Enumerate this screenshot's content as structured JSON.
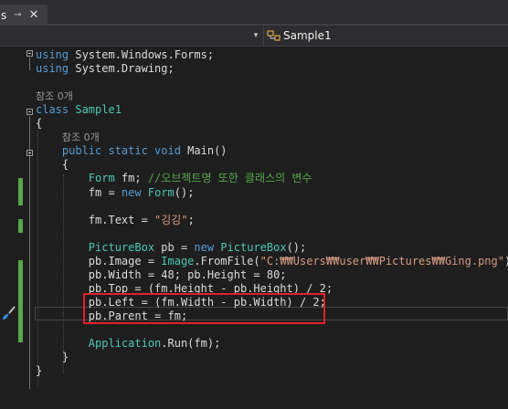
{
  "tab": {
    "label": "s",
    "pin": "⊸",
    "close": "✕"
  },
  "navbar": {
    "class_name": "Sample1",
    "chevron": "▾"
  },
  "editor": {
    "lines": [
      {
        "id": "using1",
        "tokens": [
          {
            "c": "kw",
            "t": "using"
          },
          {
            "c": "pl",
            "t": " System.Windows.Forms;"
          }
        ]
      },
      {
        "id": "using2",
        "tokens": [
          {
            "c": "kw",
            "t": "using"
          },
          {
            "c": "pl",
            "t": " System.Drawing;"
          }
        ]
      },
      {
        "id": "blank1",
        "tokens": []
      },
      {
        "id": "lens1",
        "lens": true,
        "indent": "",
        "tokens": [
          {
            "c": "lens",
            "t": "참조 0개"
          }
        ]
      },
      {
        "id": "classdecl",
        "tokens": [
          {
            "c": "kw",
            "t": "class"
          },
          {
            "c": "pl",
            "t": " "
          },
          {
            "c": "ty",
            "t": "Sample1"
          }
        ]
      },
      {
        "id": "openclass",
        "tokens": [
          {
            "c": "pl",
            "t": "{"
          }
        ]
      },
      {
        "id": "lens2",
        "lens": true,
        "indent": "    ",
        "tokens": [
          {
            "c": "lens",
            "t": "참조 0개"
          }
        ]
      },
      {
        "id": "maindecl",
        "tokens": [
          {
            "c": "pl",
            "t": "    "
          },
          {
            "c": "kw",
            "t": "public static void"
          },
          {
            "c": "pl",
            "t": " Main()"
          }
        ]
      },
      {
        "id": "openmain",
        "tokens": [
          {
            "c": "pl",
            "t": "    {"
          }
        ]
      },
      {
        "id": "formdecl",
        "tokens": [
          {
            "c": "pl",
            "t": "        "
          },
          {
            "c": "ty",
            "t": "Form"
          },
          {
            "c": "pl",
            "t": " fm; "
          },
          {
            "c": "cm",
            "t": "//오브젝트명 또한 클래스의 변수"
          }
        ]
      },
      {
        "id": "formnew",
        "tokens": [
          {
            "c": "pl",
            "t": "        fm = "
          },
          {
            "c": "kw",
            "t": "new"
          },
          {
            "c": "pl",
            "t": " "
          },
          {
            "c": "ty",
            "t": "Form"
          },
          {
            "c": "pl",
            "t": "();"
          }
        ]
      },
      {
        "id": "blank2",
        "tokens": []
      },
      {
        "id": "formtext",
        "tokens": [
          {
            "c": "pl",
            "t": "        fm.Text = "
          },
          {
            "c": "st",
            "t": "\"깅깅\""
          },
          {
            "c": "pl",
            "t": ";"
          }
        ]
      },
      {
        "id": "blank3",
        "tokens": []
      },
      {
        "id": "pbdecl",
        "tokens": [
          {
            "c": "pl",
            "t": "        "
          },
          {
            "c": "ty",
            "t": "PictureBox"
          },
          {
            "c": "pl",
            "t": " pb = "
          },
          {
            "c": "kw",
            "t": "new"
          },
          {
            "c": "pl",
            "t": " "
          },
          {
            "c": "ty",
            "t": "PictureBox"
          },
          {
            "c": "pl",
            "t": "();"
          }
        ]
      },
      {
        "id": "pbimage",
        "tokens": [
          {
            "c": "pl",
            "t": "        pb.Image = "
          },
          {
            "c": "ty",
            "t": "Image"
          },
          {
            "c": "pl",
            "t": ".FromFile("
          },
          {
            "c": "st",
            "t": "\"C:₩₩Users₩₩user₩₩Pictures₩₩Ging.png\""
          },
          {
            "c": "pl",
            "t": ");"
          }
        ]
      },
      {
        "id": "pbsize",
        "tokens": [
          {
            "c": "pl",
            "t": "        pb.Width = 48; pb.Height = 80;"
          }
        ]
      },
      {
        "id": "pbtop",
        "tokens": [
          {
            "c": "pl",
            "t": "        pb.Top = (fm.Height - pb.Height) / 2;"
          }
        ]
      },
      {
        "id": "pbleft",
        "tokens": [
          {
            "c": "pl",
            "t": "        pb.Left = (fm.Width - pb.Width) / 2;"
          }
        ]
      },
      {
        "id": "pbparent",
        "tokens": [
          {
            "c": "pl",
            "t": "        pb.Parent = fm;"
          }
        ]
      },
      {
        "id": "blank4",
        "tokens": []
      },
      {
        "id": "apprun",
        "tokens": [
          {
            "c": "pl",
            "t": "        "
          },
          {
            "c": "ty",
            "t": "Application"
          },
          {
            "c": "pl",
            "t": ".Run(fm);"
          }
        ]
      },
      {
        "id": "closemain",
        "tokens": [
          {
            "c": "pl",
            "t": "    }"
          }
        ]
      },
      {
        "id": "closeclass",
        "tokens": [
          {
            "c": "pl",
            "t": "}"
          }
        ]
      }
    ]
  }
}
